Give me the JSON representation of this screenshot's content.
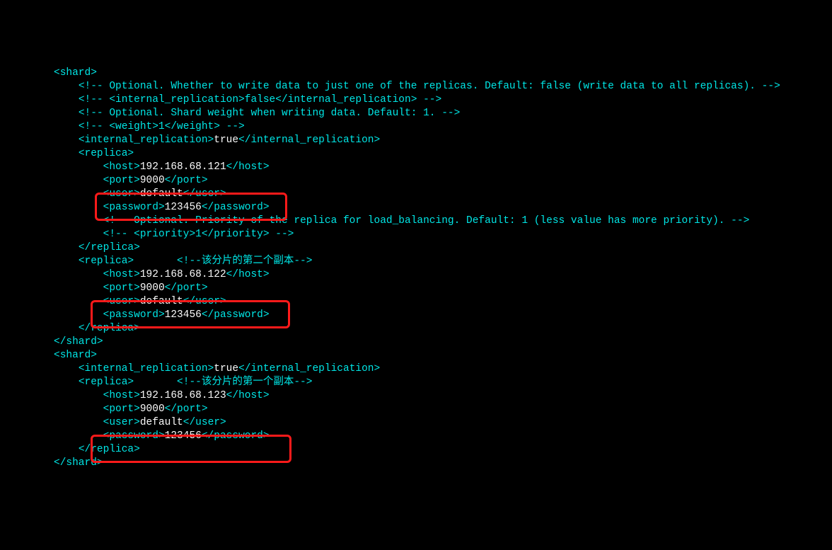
{
  "lines": [
    {
      "indent": 0,
      "spans": [
        {
          "c": "tag",
          "t": "<shard>"
        }
      ]
    },
    {
      "indent": 1,
      "spans": [
        {
          "c": "comment",
          "t": "<!-- Optional. Whether to write data to just one of the replicas. Default: false (write data to all replicas). -->"
        }
      ]
    },
    {
      "indent": 1,
      "spans": [
        {
          "c": "comment",
          "t": "<!-- <internal_replication>false</internal_replication> -->"
        }
      ]
    },
    {
      "indent": 1,
      "spans": [
        {
          "c": "comment",
          "t": "<!-- Optional. Shard weight when writing data. Default: 1. -->"
        }
      ]
    },
    {
      "indent": 1,
      "spans": [
        {
          "c": "comment",
          "t": "<!-- <weight>1</weight> -->"
        }
      ]
    },
    {
      "indent": 1,
      "spans": [
        {
          "c": "tag",
          "t": "<internal_replication>"
        },
        {
          "c": "text",
          "t": "true"
        },
        {
          "c": "tag",
          "t": "</internal_replication>"
        }
      ]
    },
    {
      "indent": 1,
      "spans": [
        {
          "c": "tag",
          "t": "<replica>"
        }
      ]
    },
    {
      "indent": 2,
      "spans": [
        {
          "c": "tag",
          "t": "<host>"
        },
        {
          "c": "text",
          "t": "192.168.68.121"
        },
        {
          "c": "tag",
          "t": "</host>"
        }
      ]
    },
    {
      "indent": 2,
      "spans": [
        {
          "c": "tag",
          "t": "<port>"
        },
        {
          "c": "text",
          "t": "9000"
        },
        {
          "c": "tag",
          "t": "</port>"
        }
      ]
    },
    {
      "indent": 2,
      "spans": [
        {
          "c": "tag",
          "t": "<user>"
        },
        {
          "c": "text",
          "t": "default"
        },
        {
          "c": "tag",
          "t": "</user>"
        }
      ]
    },
    {
      "indent": 2,
      "spans": [
        {
          "c": "tag",
          "t": "<password>"
        },
        {
          "c": "text",
          "t": "123456"
        },
        {
          "c": "tag",
          "t": "</password>"
        }
      ]
    },
    {
      "indent": 2,
      "spans": [
        {
          "c": "comment",
          "t": "<!-- Optional. Priority of the replica for load_balancing. Default: 1 (less value has more priority). -->"
        }
      ]
    },
    {
      "indent": 2,
      "spans": [
        {
          "c": "comment",
          "t": "<!-- <priority>1</priority> -->"
        }
      ]
    },
    {
      "indent": 1,
      "spans": [
        {
          "c": "tag",
          "t": "</replica>"
        }
      ]
    },
    {
      "indent": 1,
      "spans": [
        {
          "c": "tag",
          "t": "<replica>       "
        },
        {
          "c": "comment",
          "t": "<!--该分片的第二个副本-->"
        }
      ]
    },
    {
      "indent": 2,
      "spans": [
        {
          "c": "tag",
          "t": "<host>"
        },
        {
          "c": "text",
          "t": "192.168.68.122"
        },
        {
          "c": "tag",
          "t": "</host>"
        }
      ]
    },
    {
      "indent": 2,
      "spans": [
        {
          "c": "tag",
          "t": "<port>"
        },
        {
          "c": "text",
          "t": "9000"
        },
        {
          "c": "tag",
          "t": "</port>"
        }
      ]
    },
    {
      "indent": 2,
      "spans": [
        {
          "c": "tag",
          "t": "<user>"
        },
        {
          "c": "text",
          "t": "default"
        },
        {
          "c": "tag",
          "t": "</user>"
        }
      ]
    },
    {
      "indent": 2,
      "spans": [
        {
          "c": "tag",
          "t": "<password>"
        },
        {
          "c": "text",
          "t": "123456"
        },
        {
          "c": "tag",
          "t": "</password>"
        }
      ]
    },
    {
      "indent": 1,
      "spans": [
        {
          "c": "tag",
          "t": "</replica>"
        }
      ]
    },
    {
      "indent": 0,
      "spans": [
        {
          "c": "tag",
          "t": "</shard>"
        }
      ]
    },
    {
      "indent": 0,
      "spans": [
        {
          "c": "tag",
          "t": "<shard>"
        }
      ]
    },
    {
      "indent": 1,
      "spans": [
        {
          "c": "tag",
          "t": "<internal_replication>"
        },
        {
          "c": "text",
          "t": "true"
        },
        {
          "c": "tag",
          "t": "</internal_replication>"
        }
      ]
    },
    {
      "indent": 1,
      "spans": [
        {
          "c": "tag",
          "t": "<replica>       "
        },
        {
          "c": "comment",
          "t": "<!--该分片的第一个副本-->"
        }
      ]
    },
    {
      "indent": 2,
      "spans": [
        {
          "c": "tag",
          "t": "<host>"
        },
        {
          "c": "text",
          "t": "192.168.68.123"
        },
        {
          "c": "tag",
          "t": "</host>"
        }
      ]
    },
    {
      "indent": 2,
      "spans": [
        {
          "c": "tag",
          "t": "<port>"
        },
        {
          "c": "text",
          "t": "9000"
        },
        {
          "c": "tag",
          "t": "</port>"
        }
      ]
    },
    {
      "indent": 2,
      "spans": [
        {
          "c": "tag",
          "t": "<user>"
        },
        {
          "c": "text",
          "t": "default"
        },
        {
          "c": "tag",
          "t": "</user>"
        }
      ]
    },
    {
      "indent": 2,
      "spans": [
        {
          "c": "tag",
          "t": "<password>"
        },
        {
          "c": "text",
          "t": "123456"
        },
        {
          "c": "tag",
          "t": "</password>"
        }
      ]
    },
    {
      "indent": 1,
      "spans": [
        {
          "c": "tag",
          "t": "</replica>"
        }
      ]
    },
    {
      "indent": 0,
      "spans": [
        {
          "c": "tag",
          "t": "</shard>"
        }
      ]
    }
  ],
  "indent_unit": "    "
}
